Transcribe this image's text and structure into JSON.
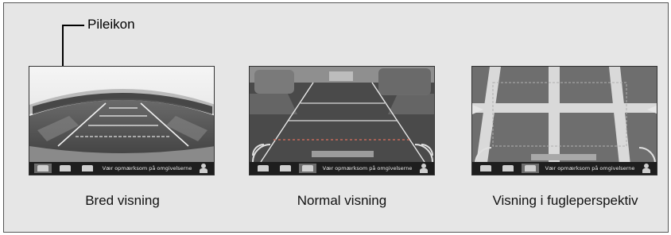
{
  "callout": {
    "label": "Pileikon"
  },
  "views": [
    {
      "caption": "Bred visning",
      "message": "Vær opmærksom på omgivelserne"
    },
    {
      "caption": "Normal visning",
      "message": "Vær opmærksom på omgivelserne"
    },
    {
      "caption": "Visning i fugleperspektiv",
      "message": "Vær opmærksom på omgivelserne"
    }
  ],
  "icons": [
    "wide-view-icon",
    "normal-view-icon",
    "top-view-icon",
    "pedestrian-icon"
  ]
}
